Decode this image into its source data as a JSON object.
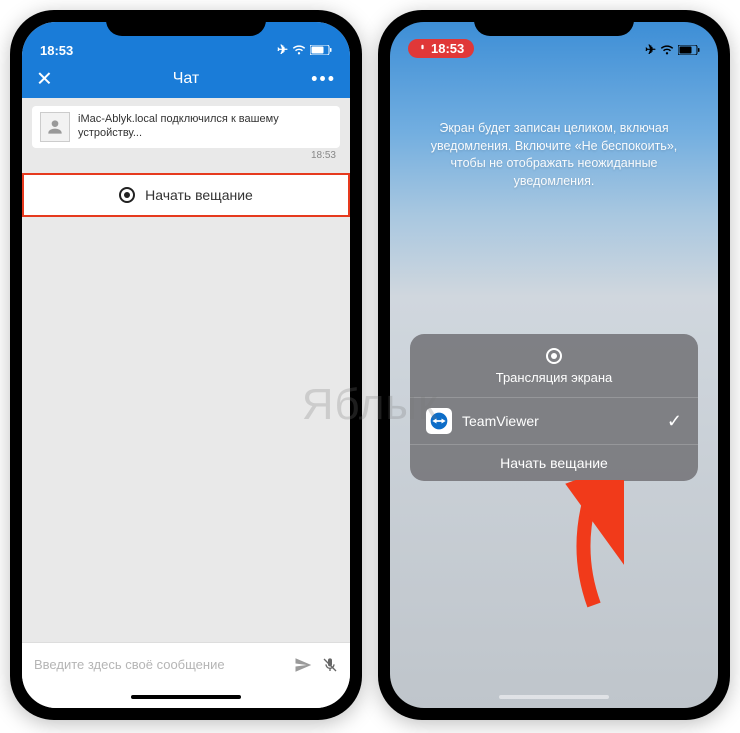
{
  "watermark": "Яблык",
  "left": {
    "status": {
      "time": "18:53"
    },
    "nav": {
      "title": "Чат"
    },
    "message": {
      "text": "iMac-Ablyk.local подключился к вашему устройству...",
      "time": "18:53"
    },
    "broadcast_label": "Начать вещание",
    "input_placeholder": "Введите здесь своё сообщение"
  },
  "right": {
    "status": {
      "time_pill": "18:53"
    },
    "info": "Экран будет записан целиком, включая уведомления. Включите «Не беспокоить», чтобы не отображать неожиданные уведомления.",
    "modal": {
      "title": "Трансляция экрана",
      "app": "TeamViewer",
      "start_label": "Начать вещание"
    }
  }
}
